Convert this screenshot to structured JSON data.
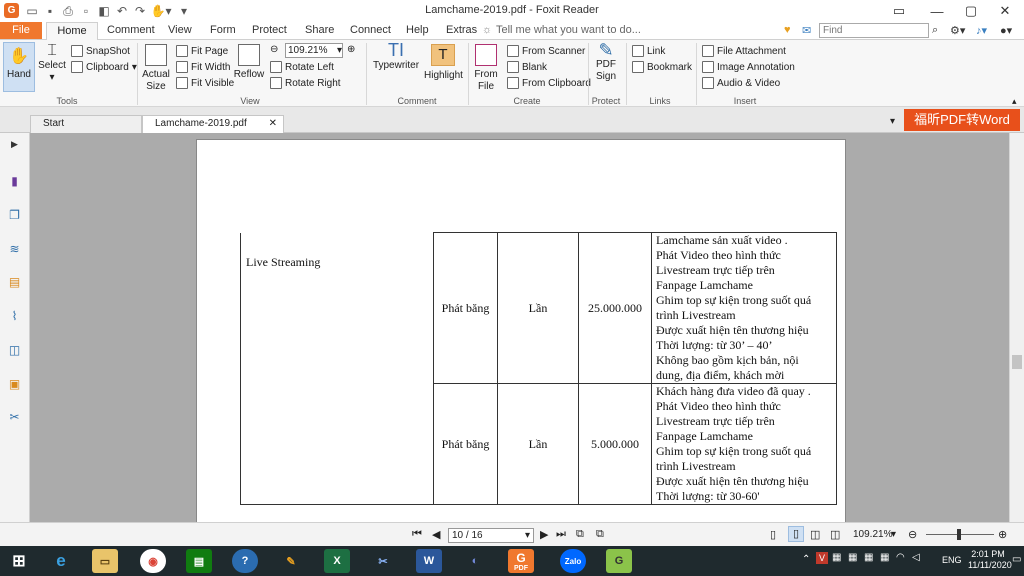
{
  "window": {
    "title": "Lamchame-2019.pdf - Foxit Reader"
  },
  "menubar": {
    "file": "File",
    "tabs": [
      "Home",
      "Comment",
      "View",
      "Form",
      "Protect",
      "Share",
      "Connect",
      "Help",
      "Extras"
    ],
    "tell_me": "Tell me what you want to do...",
    "find_placeholder": "Find"
  },
  "ribbon": {
    "tools": {
      "label": "Tools",
      "hand": "Hand",
      "select": "Select",
      "snapshot": "SnapShot",
      "clipboard": "Clipboard"
    },
    "view": {
      "label": "View",
      "actual_size_1": "Actual",
      "actual_size_2": "Size",
      "fit_page": "Fit Page",
      "fit_width": "Fit Width",
      "fit_visible": "Fit Visible",
      "reflow": "Reflow",
      "zoom": "109.21%",
      "rotate_left": "Rotate Left",
      "rotate_right": "Rotate Right"
    },
    "comment": {
      "label": "Comment",
      "typewriter": "Typewriter",
      "highlight": "Highlight"
    },
    "create": {
      "label": "Create",
      "from_file_1": "From",
      "from_file_2": "File",
      "from_scanner": "From Scanner",
      "blank": "Blank",
      "from_clipboard": "From Clipboard"
    },
    "protect": {
      "label": "Protect",
      "pdf_sign_1": "PDF",
      "pdf_sign_2": "Sign"
    },
    "links": {
      "label": "Links",
      "link": "Link",
      "bookmark": "Bookmark"
    },
    "insert": {
      "label": "Insert",
      "file_attachment": "File Attachment",
      "image_annotation": "Image Annotation",
      "audio_video": "Audio & Video"
    }
  },
  "tabs": {
    "start": "Start",
    "doc": "Lamchame-2019.pdf",
    "convert": "福昕PDF转Word"
  },
  "document": {
    "service": "Live Streaming",
    "rows": [
      {
        "type": "Phát băng",
        "unit": "Lần",
        "price": "25.000.000",
        "desc": [
          "Lamchame sản xuất video .",
          "Phát Video theo hình thức",
          "Livestream trực tiếp trên",
          "Fanpage Lamchame",
          "Ghim top sự kiện trong suốt quá",
          "trình Livestream",
          "Được xuất hiện tên thương hiệu",
          "Thời lượng: từ 30’ – 40’",
          "Không bao gồm kịch bản, nội",
          "dung, địa điểm, khách mời"
        ]
      },
      {
        "type": "Phát băng",
        "unit": "Lần",
        "price": "5.000.000",
        "desc": [
          "Khách hàng đưa video đã quay .",
          "Phát Video theo hình thức",
          "Livestream trực tiếp trên",
          "Fanpage Lamchame",
          "Ghim top sự kiện trong suốt quá",
          "trình Livestream",
          "Được xuất hiện tên thương hiệu",
          "Thời lượng: từ 30-60'"
        ]
      }
    ]
  },
  "status": {
    "page": "10 / 16",
    "zoom": "109.21%"
  },
  "taskbar": {
    "lang": "ENG",
    "time": "2:01 PM",
    "date": "11/11/2020",
    "pdf_label": "PDF",
    "zalo": "Zalo"
  },
  "colors": {
    "accent": "#f0782e",
    "convert": "#e8501b",
    "taskbar": "#1f2a2e"
  }
}
